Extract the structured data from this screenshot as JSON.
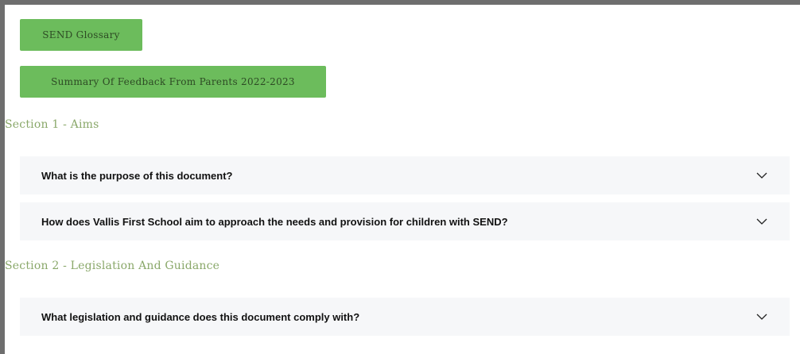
{
  "buttons": {
    "glossary": "SEND Glossary",
    "feedback": "Summary Of Feedback From Parents 2022-2023"
  },
  "sections": [
    {
      "heading": "Section 1 - Aims",
      "items": [
        "What is the purpose of this document?",
        "How does Vallis First School aim to approach the needs and provision for children with SEND?"
      ]
    },
    {
      "heading": "Section 2 - Legislation And Guidance",
      "items": [
        "What legislation and guidance does this document comply with?"
      ]
    }
  ],
  "icons": {
    "accordion_toggle": "chevron-down-icon"
  },
  "colors": {
    "button_bg": "#6cbc5c",
    "heading": "#8aa86a",
    "accordion_bg": "#f6f7f9",
    "frame_border": "#6e6e6e"
  }
}
